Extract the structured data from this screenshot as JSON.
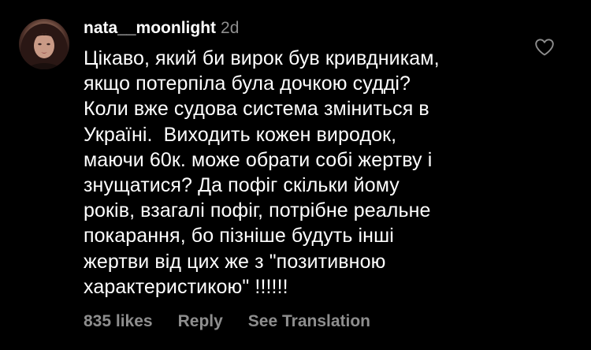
{
  "comment": {
    "username": "nata__moonlight",
    "time": "2d",
    "text": "Цікаво, який би вирок був кривдникам,\nякщо потерпіла була дочкою судді?\nКоли вже судова система зміниться в\nУкраїні.  Виходить кожен виродок,\nмаючи 60к. може обрати собі жертву і\nзнущатися? Да пофіг скільки йому\nроків, взагалі пофіг, потрібне реальне\nпокарання, бо пізніше будуть інші\nжертви від цих же з \"позитивною\nхарактеристикою\" !!!!!!",
    "likes": "835 likes",
    "reply_label": "Reply",
    "translation_label": "See Translation",
    "like_icon": "heart-outline-icon"
  },
  "colors": {
    "background": "#000000",
    "text": "#ffffff",
    "muted": "#8e8e8e"
  }
}
